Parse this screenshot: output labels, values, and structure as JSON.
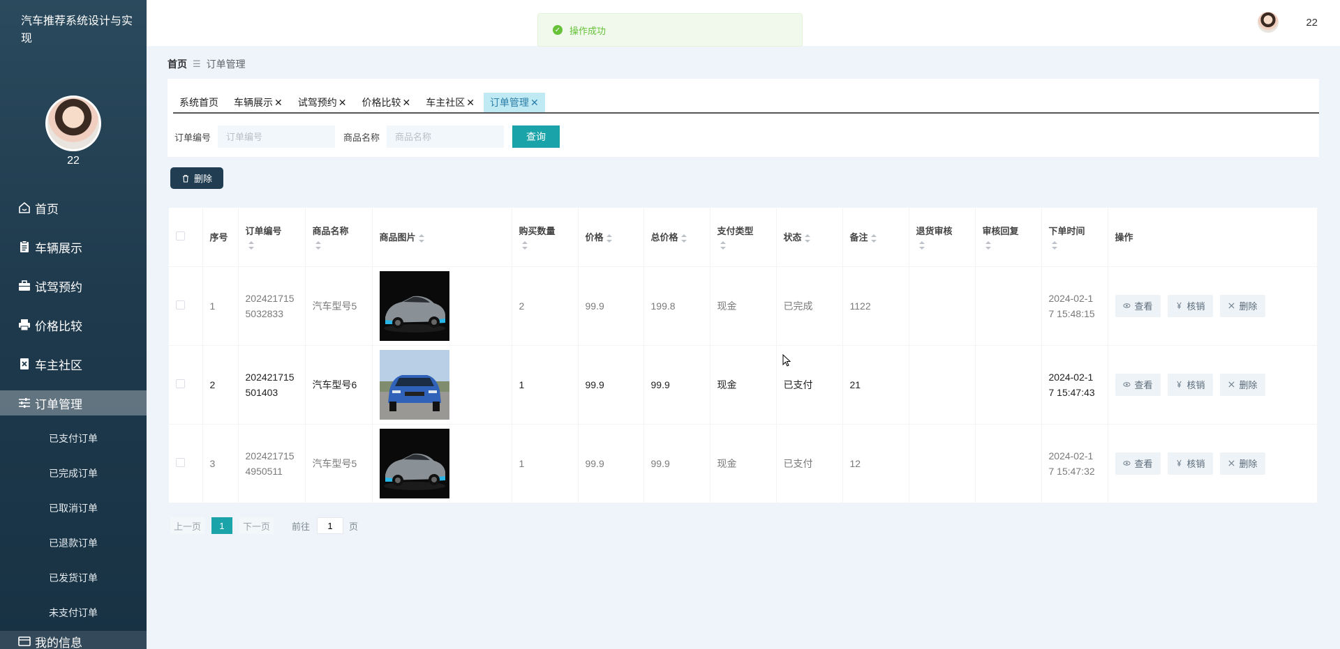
{
  "app": {
    "title": "汽车推荐系统设计与实现",
    "username": "22"
  },
  "toast": {
    "message": "操作成功"
  },
  "sidebar": {
    "items": [
      {
        "label": "首页",
        "icon": "home-icon"
      },
      {
        "label": "车辆展示",
        "icon": "clipboard-icon"
      },
      {
        "label": "试驾预约",
        "icon": "briefcase-icon"
      },
      {
        "label": "价格比较",
        "icon": "printer-icon"
      },
      {
        "label": "车主社区",
        "icon": "document-x-icon"
      },
      {
        "label": "订单管理",
        "icon": "sliders-icon",
        "active": true
      }
    ],
    "subitems": [
      "已支付订单",
      "已完成订单",
      "已取消订单",
      "已退款订单",
      "已发货订单",
      "未支付订单"
    ],
    "bottom_item": "我的信息"
  },
  "breadcrumb": {
    "home": "首页",
    "current": "订单管理"
  },
  "tabs": [
    {
      "label": "系统首页",
      "closable": false
    },
    {
      "label": "车辆展示",
      "closable": true
    },
    {
      "label": "试驾预约",
      "closable": true
    },
    {
      "label": "价格比较",
      "closable": true
    },
    {
      "label": "车主社区",
      "closable": true
    },
    {
      "label": "订单管理",
      "closable": true,
      "active": true
    }
  ],
  "search": {
    "order_label": "订单编号",
    "order_placeholder": "订单编号",
    "product_label": "商品名称",
    "product_placeholder": "商品名称",
    "query_button": "查询"
  },
  "toolbar": {
    "delete_button": "删除"
  },
  "table": {
    "headers": {
      "index": "序号",
      "order_no": "订单编号",
      "product_name": "商品名称",
      "product_image": "商品图片",
      "quantity": "购买数量",
      "price": "价格",
      "total": "总价格",
      "pay_type": "支付类型",
      "status": "状态",
      "remark": "备注",
      "return_review": "退货审核",
      "review_reply": "审核回复",
      "order_time": "下单时间",
      "actions": "操作"
    },
    "actions": {
      "view": "查看",
      "verify": "核销",
      "delete": "删除"
    },
    "rows": [
      {
        "index": "1",
        "order_no": "2024217155032833",
        "order_no_l1": "202421715",
        "order_no_l2": "5032833",
        "product_name": "汽车型号5",
        "image": "gray-sports-car",
        "quantity": "2",
        "price": "99.9",
        "total": "199.8",
        "pay_type": "现金",
        "status": "已完成",
        "remark": "1122",
        "return_review": "",
        "review_reply": "",
        "time_l1": "2024-02-1",
        "time_l2": "7 15:48:15"
      },
      {
        "index": "2",
        "order_no": "202421715501403",
        "order_no_l1": "202421715",
        "order_no_l2": "501403",
        "product_name": "汽车型号6",
        "image": "blue-suv",
        "quantity": "1",
        "price": "99.9",
        "total": "99.9",
        "pay_type": "现金",
        "status": "已支付",
        "remark": "21",
        "return_review": "",
        "review_reply": "",
        "time_l1": "2024-02-1",
        "time_l2": "7 15:47:43"
      },
      {
        "index": "3",
        "order_no": "2024217154950511",
        "order_no_l1": "202421715",
        "order_no_l2": "4950511",
        "product_name": "汽车型号5",
        "image": "gray-sports-car",
        "quantity": "1",
        "price": "99.9",
        "total": "99.9",
        "pay_type": "现金",
        "status": "已支付",
        "remark": "12",
        "return_review": "",
        "review_reply": "",
        "time_l1": "2024-02-1",
        "time_l2": "7 15:47:32"
      }
    ]
  },
  "pager": {
    "prev": "上一页",
    "current": "1",
    "next": "下一页",
    "goto_label": "前往",
    "goto_value": "1",
    "page_unit": "页"
  },
  "colors": {
    "sidebar": "#1f3a4d",
    "accent": "#1aa3a8",
    "success": "#67c23a",
    "page_bg": "#eef4fa"
  }
}
